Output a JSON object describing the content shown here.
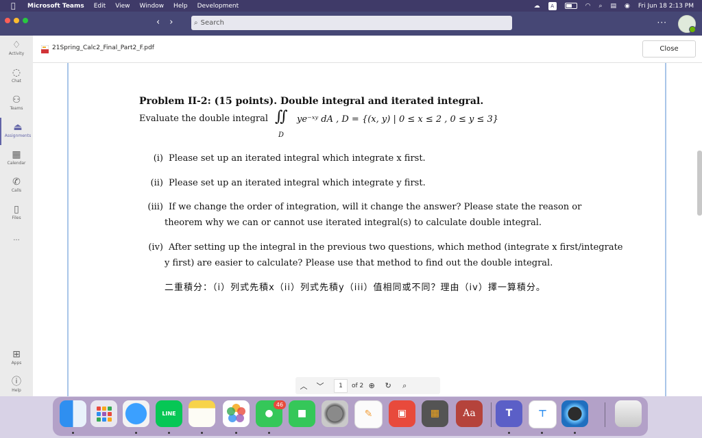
{
  "menubar": {
    "app_name": "Microsoft Teams",
    "items": [
      "Edit",
      "View",
      "Window",
      "Help",
      "Development"
    ],
    "clock": "Fri Jun 18  2:13 PM"
  },
  "titlebar": {
    "search_placeholder": "Search",
    "more_label": "···"
  },
  "sidebar": {
    "items": [
      {
        "label": "Activity",
        "icon": "bell-icon"
      },
      {
        "label": "Chat",
        "icon": "chat-icon"
      },
      {
        "label": "Teams",
        "icon": "teams-icon"
      },
      {
        "label": "Assignments",
        "icon": "assignments-icon"
      },
      {
        "label": "Calendar",
        "icon": "calendar-icon"
      },
      {
        "label": "Calls",
        "icon": "phone-icon"
      },
      {
        "label": "Files",
        "icon": "file-icon"
      }
    ],
    "more_label": "···",
    "bottom_items": [
      {
        "label": "Apps",
        "icon": "apps-icon"
      },
      {
        "label": "Help",
        "icon": "help-icon"
      }
    ]
  },
  "file": {
    "name": "21Spring_Calc2_Final_Part2_F.pdf",
    "close_label": "Close"
  },
  "document": {
    "heading": "Problem II-2: (15 points). Double integral and iterated integral.",
    "eval_text": "Evaluate the double integral",
    "integral_sign": "∬",
    "integral_domain": "D",
    "formula": "ye⁻ˣʸ dA ,  D = {(x, y) | 0 ≤ x ≤ 2 , 0 ≤ y ≤ 3}",
    "items": [
      {
        "num": "(i)",
        "text": "Please set up an iterated integral which integrate x first."
      },
      {
        "num": "(ii)",
        "text": "Please set up an iterated integral which integrate y first."
      },
      {
        "num": "(iii)",
        "text": "If we change the order of integration, will it change the answer?  Please state the reason or",
        "cont": "theorem why we can or cannot use iterated integral(s) to calculate double integral."
      },
      {
        "num": "(iv)",
        "text": "After setting up the integral in the previous two questions, which method (integrate x first/integrate",
        "cont": "y first) are easier to calculate? Please use that method to find out the double integral."
      }
    ],
    "chinese": "二重積分：（i）列式先積x（ii）列式先積y（iii）值相同或不同？理由（iv）擇一算積分。"
  },
  "pdf_toolbar": {
    "page": "1",
    "of_pages": "of 2"
  },
  "dock": {
    "badge_count": "46",
    "apps": [
      "Finder",
      "Launchpad",
      "Safari",
      "LINE",
      "Notes",
      "Photos",
      "Messages",
      "FaceTime",
      "System Preferences",
      "Script Editor",
      "Photo Booth",
      "Calculator",
      "Dictionary",
      "Microsoft Teams",
      "Keynote",
      "QuickTime Player",
      "Trash"
    ],
    "line_label": "LINE",
    "dictionary_label": "Aa"
  },
  "colors": {
    "menubar": "#3f3a68",
    "titlebar": "#464775",
    "accent": "#6264a7",
    "page_border": "#a8c5e8"
  }
}
